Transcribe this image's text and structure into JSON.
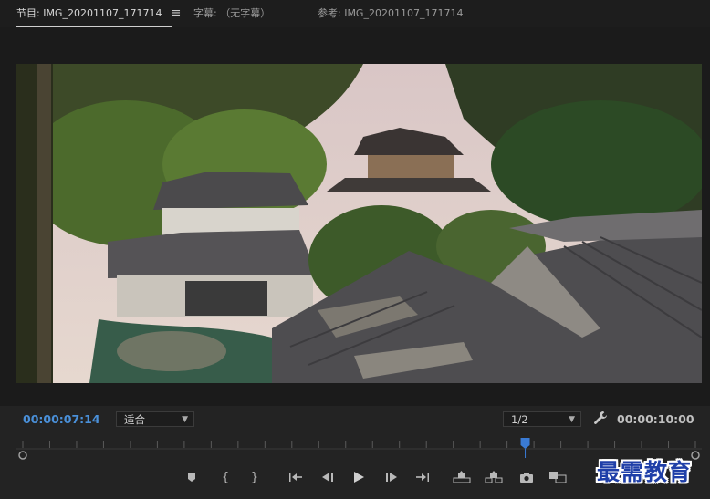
{
  "tabs": [
    {
      "label": "节目: IMG_20201107_171714"
    },
    {
      "label": "字幕: （无字幕）"
    },
    {
      "label": "参考: IMG_20201107_171714"
    }
  ],
  "tab_menu_icon": "≡",
  "timecode_current": "00:00:07:14",
  "timecode_duration": "00:00:10:00",
  "zoom_select": {
    "value": "适合"
  },
  "resolution_select": {
    "value": "1/2"
  },
  "playhead_fraction": 0.747,
  "transport": {
    "icons": [
      "marker-icon",
      "mark-in-icon",
      "mark-out-icon",
      "go-to-in-icon",
      "step-back-icon",
      "play-icon",
      "step-forward-icon",
      "go-to-out-icon",
      "lift-icon",
      "extract-icon",
      "camera-icon",
      "comparison-view-icon"
    ],
    "mark_in_glyph": "{",
    "mark_out_glyph": "}"
  },
  "watermark": "最需教育",
  "colors": {
    "accent_blue": "#4a90d9",
    "playhead": "#3a7bd5",
    "watermark": "#1f3fa8"
  }
}
